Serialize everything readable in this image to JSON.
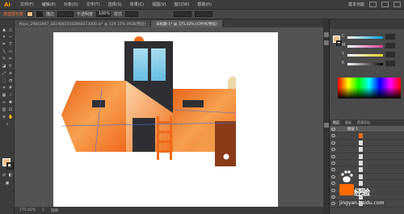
{
  "app": {
    "logo": "Ai",
    "menus": [
      "文件(F)",
      "编辑(E)",
      "对象(O)",
      "文字(T)",
      "选择(S)",
      "效果(C)",
      "视图(V)",
      "窗口(W)",
      "帮助(H)"
    ],
    "workspace": "基本功能"
  },
  "control": {
    "selection_label": "未选择对象",
    "stroke_label": "描边",
    "stroke_value": "",
    "opacity_label": "不透明度",
    "opacity_value": "100%",
    "style_label": "样式",
    "x_value": "",
    "y_value": ""
  },
  "tabs": [
    {
      "label": "Nipic_29843907_20190815102964213000.ai* @ 129.15% (RGB/预览)"
    },
    {
      "label": "未标题-1* @ 175.42% (CMYK/预览)"
    }
  ],
  "color_panel": {
    "colors": {
      "fill": "#f7c08a",
      "accent": "#f07020"
    },
    "sliders": [
      {
        "label": "C",
        "value": "",
        "color": "#e04040"
      },
      {
        "label": "M",
        "value": "",
        "color": "#e040a0"
      },
      {
        "label": "Y",
        "value": "",
        "color": "#e0c020"
      },
      {
        "label": "K",
        "value": "",
        "color": "#c08060"
      }
    ]
  },
  "layers_panel": {
    "tabs": [
      "图层",
      "画板",
      "资源导出"
    ],
    "layers": [
      {
        "name": "图层 1"
      },
      {
        "name": ""
      },
      {
        "name": ""
      },
      {
        "name": ""
      },
      {
        "name": ""
      },
      {
        "name": ""
      },
      {
        "name": ""
      },
      {
        "name": ""
      },
      {
        "name": ""
      },
      {
        "name": ""
      },
      {
        "name": ""
      },
      {
        "name": ""
      }
    ]
  },
  "statusbar": {
    "zoom": "175.42%",
    "page": "1",
    "tool_label": "选择"
  },
  "watermark": {
    "text": "经验",
    "url": "jingyan.baidu.com"
  },
  "icons": [
    "selection-icon",
    "direct-selection-icon",
    "magic-wand-icon",
    "lasso-icon",
    "pen-icon",
    "type-icon",
    "line-icon",
    "rectangle-icon",
    "paintbrush-icon",
    "pencil-icon",
    "eraser-icon",
    "rotate-icon",
    "scale-icon",
    "width-icon",
    "free-transform-icon",
    "shape-builder-icon",
    "perspective-icon",
    "mesh-icon",
    "gradient-icon",
    "eyedropper-icon",
    "blend-icon",
    "symbol-sprayer-icon",
    "graph-icon",
    "artboard-icon",
    "slice-icon",
    "hand-icon",
    "zoom-icon"
  ]
}
